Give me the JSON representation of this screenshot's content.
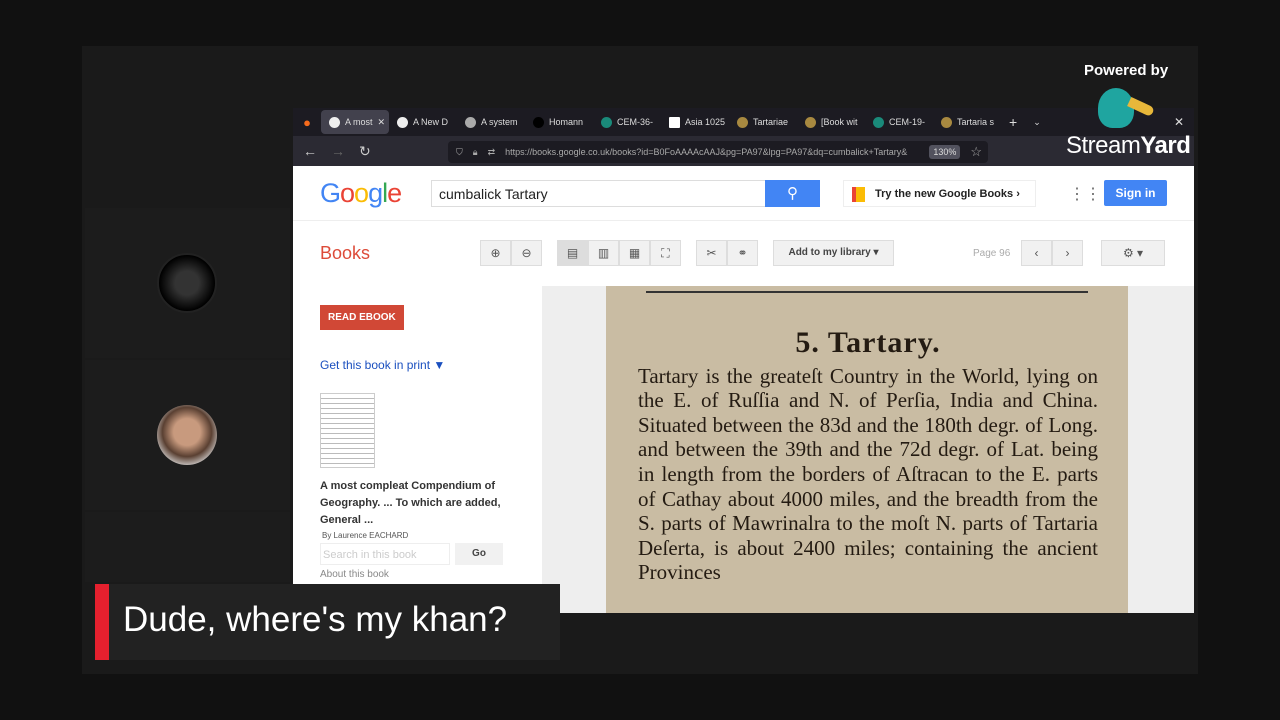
{
  "streamyard": {
    "powered_by": "Powered by",
    "brand_stream": "Stream",
    "brand_yard": "Yard"
  },
  "browser": {
    "tabs": [
      "A most",
      "A New D",
      "A system",
      "Homann",
      "CEM-36-",
      "Asia 1025",
      "Tartariae",
      "[Book wit",
      "CEM-19-",
      "Tartaria s"
    ],
    "url": "https://books.google.co.uk/books?id=B0FoAAAAcAAJ&pg=PA97&lpg=PA97&dq=cumbalick+Tartary&",
    "zoom": "130%"
  },
  "google": {
    "logo": "Google",
    "search_value": "cumbalick Tartary",
    "try_new": "Try the new Google Books",
    "sign_in": "Sign in"
  },
  "toolbar": {
    "books": "Books",
    "add_library": "Add to my library ▾",
    "page": "Page 96"
  },
  "sidebar": {
    "read_ebook": "READ EBOOK",
    "get_print": "Get this book in print ▼",
    "title": "A most compleat Compendium of Geography. ... To which are added, General ...",
    "author": "By Laurence EACHARD",
    "search_placeholder": "Search in this book",
    "go": "Go",
    "about": "About this book"
  },
  "book_page": {
    "heading": "5. Tartary.",
    "text": "Tartary is the greateſt Country in the World, lying on the E. of Ruſſia and N. of Perſia, India and China. Situated between the 83d and the 180th degr. of Long. and between the 39th and the 72d degr. of Lat. being in length from the borders of Aſtracan to the E. parts of Cathay about 4000 miles, and the breadth from the S. parts of Mawrinalra to the moſt N. parts of Tartaria Deſerta, is about 2400 miles; containing the ancient Provinces"
  },
  "caption": "Dude, where's my khan?"
}
